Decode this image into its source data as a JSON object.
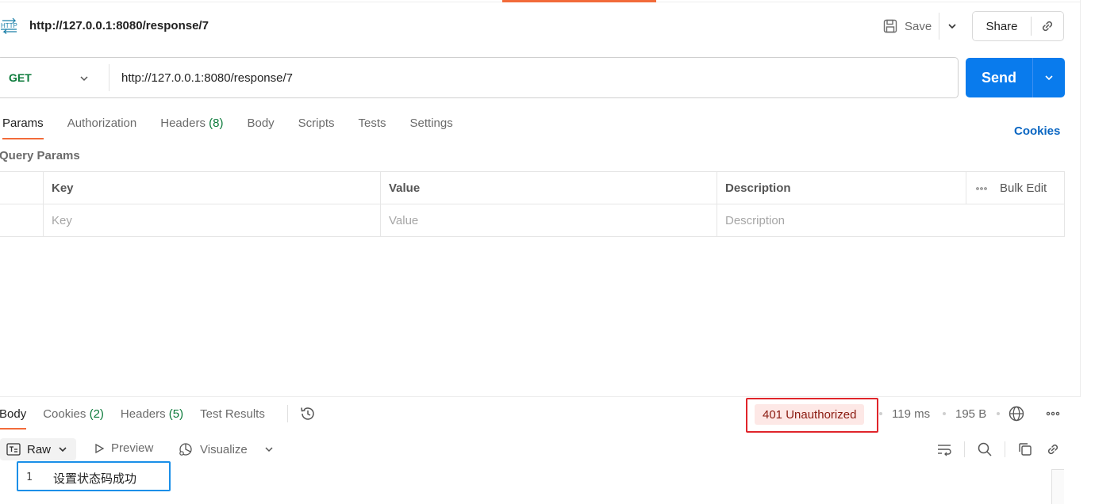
{
  "request": {
    "title": "http://127.0.0.1:8080/response/7",
    "icon_badge": "HTTP",
    "save_label": "Save",
    "share_label": "Share",
    "method": "GET",
    "url": "http://127.0.0.1:8080/response/7",
    "send_label": "Send"
  },
  "request_tabs": [
    {
      "label": "Params",
      "count": ""
    },
    {
      "label": "Authorization",
      "count": ""
    },
    {
      "label": "Headers",
      "count": "(8)"
    },
    {
      "label": "Body",
      "count": ""
    },
    {
      "label": "Scripts",
      "count": ""
    },
    {
      "label": "Tests",
      "count": ""
    },
    {
      "label": "Settings",
      "count": ""
    }
  ],
  "cookies_link": "Cookies",
  "query_params": {
    "title": "Query Params",
    "headers": {
      "key": "Key",
      "value": "Value",
      "description": "Description",
      "bulk_edit": "Bulk Edit"
    },
    "placeholders": {
      "key": "Key",
      "value": "Value",
      "description": "Description"
    }
  },
  "response_tabs": [
    {
      "label": "Body",
      "count": ""
    },
    {
      "label": "Cookies",
      "count": "(2)"
    },
    {
      "label": "Headers",
      "count": "(5)"
    },
    {
      "label": "Test Results",
      "count": ""
    }
  ],
  "response_meta": {
    "status": "401 Unauthorized",
    "time": "119 ms",
    "size": "195 B"
  },
  "response_toolbar": {
    "format": "Raw",
    "preview": "Preview",
    "visualize": "Visualize"
  },
  "response_body": {
    "line_number": "1",
    "text": "设置状态码成功"
  },
  "colors": {
    "accent": "#f26b3a",
    "send": "#097bed",
    "method_get": "#0b7a3a",
    "status_error_bg": "#fde8e6",
    "status_error_text": "#8b1a10",
    "annotation_red": "#e0252b",
    "annotation_blue": "#1a8fe8",
    "link": "#0a66c2"
  }
}
